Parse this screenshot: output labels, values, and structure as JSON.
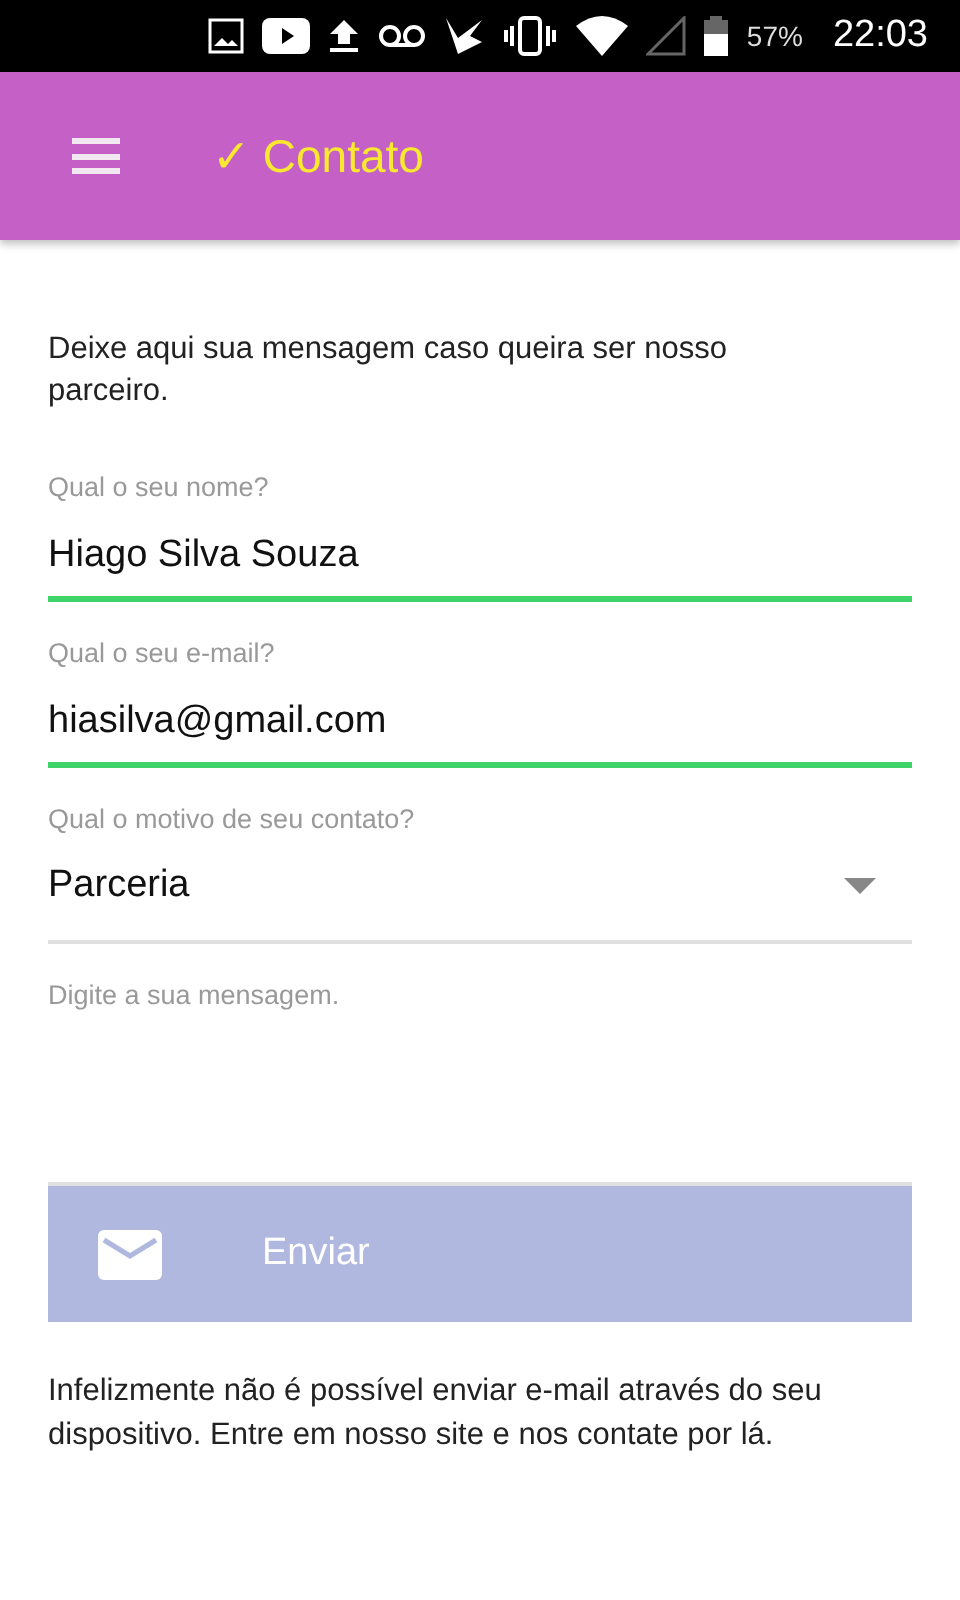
{
  "status_bar": {
    "battery": "57%",
    "time": "22:03"
  },
  "app_bar": {
    "title": "✓ Contato"
  },
  "intro": "Deixe aqui sua mensagem caso queira ser nosso parceiro.",
  "fields": [
    {
      "kind": "text",
      "label": "Qual o seu nome?",
      "value": "Hiago Silva Souza",
      "valid": true
    },
    {
      "kind": "text",
      "label": "Qual o seu e-mail?",
      "value": "hiasilva@gmail.com",
      "valid": true
    },
    {
      "kind": "select",
      "label": "Qual o motivo de seu contato?",
      "value": "Parceria",
      "valid": false
    },
    {
      "kind": "textarea",
      "placeholder": "Digite a sua mensagem.",
      "valid": false
    }
  ],
  "send_button": {
    "label": "Enviar",
    "disabled": true
  },
  "notice": "Infelizmente não é possível enviar e-mail através do seu dispositivo. Entre em nosso site e nos contate por lá."
}
